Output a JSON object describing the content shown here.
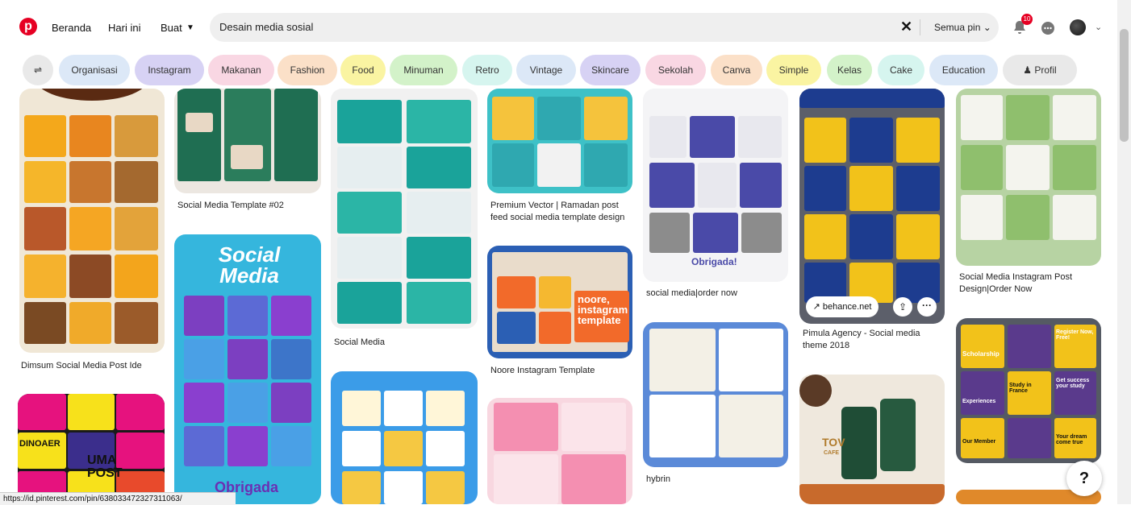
{
  "header": {
    "nav": {
      "home": "Beranda",
      "today": "Hari ini",
      "create": "Buat"
    },
    "search": {
      "value": "Desain media sosial",
      "scope": "Semua pin"
    },
    "notification_count": "10"
  },
  "filters": [
    "Organisasi",
    "Instagram",
    "Makanan",
    "Fashion",
    "Food",
    "Minuman",
    "Retro",
    "Vintage",
    "Skincare",
    "Sekolah",
    "Canva",
    "Simple",
    "Kelas",
    "Cake",
    "Education",
    "Profil"
  ],
  "pins": {
    "dimsum": "Dimsum Social Media Post Ide",
    "template02": "Social Media Template #02",
    "social_media_text": "Social Media",
    "obrigada": "Obrigada",
    "social_media_caption": "Social Media",
    "ramadan": "Premium Vector | Ramadan post feed social media template design",
    "noore_text1": "noore,",
    "noore_text2": "instagram",
    "noore_text3": "template",
    "noore_caption": "Noore Instagram Template",
    "sm_order": "social media|order now",
    "obrigada2": "Obrigada!",
    "hybrin": "hybrin",
    "behance": "behance.net",
    "pimula": "Pimula Agency - Social media theme 2018",
    "ig_post": "Social Media Instagram Post Design|Order Now",
    "scholarship": "Scholarship",
    "register": "Register Now, Free!",
    "get_success": "Get success your study",
    "study_france": "Study in France",
    "experiences": "Experiences",
    "our_member": "Our Member",
    "your_dream": "Your dream come true",
    "uma": "UMA POST",
    "dinoaer": "DINOAER",
    "tov": "TOV",
    "tov_cafe": "CAFE"
  },
  "status_url": "https://id.pinterest.com/pin/638033472327311063/",
  "help_label": "?"
}
